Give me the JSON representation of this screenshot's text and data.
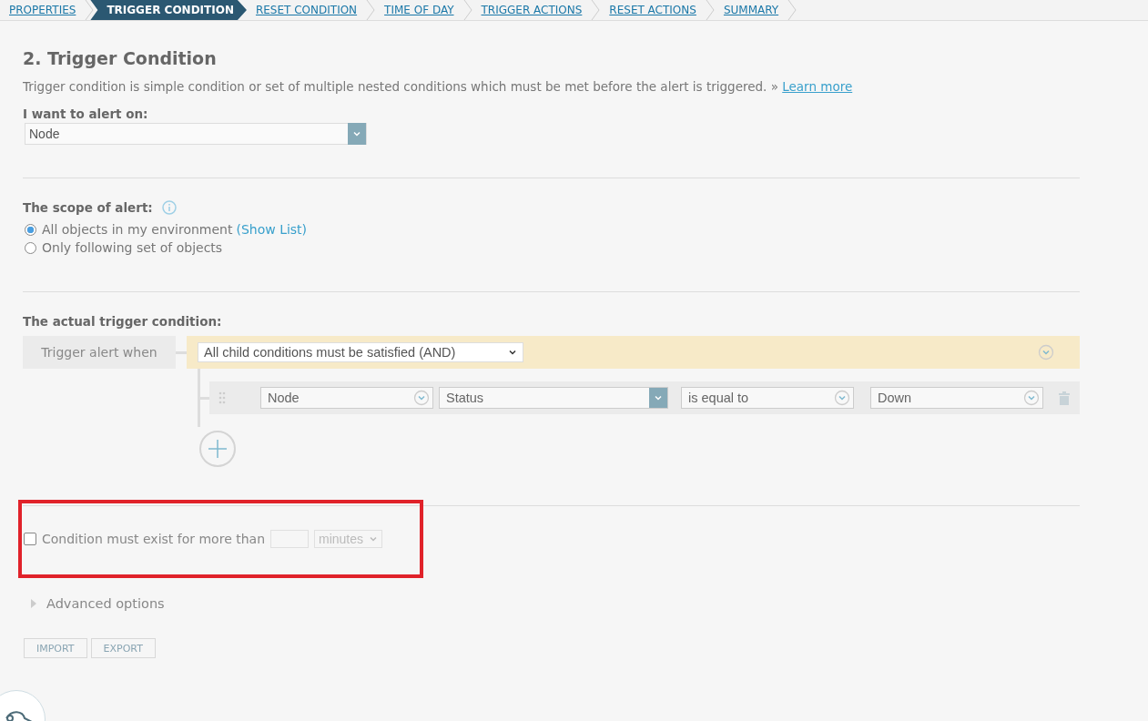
{
  "breadcrumb": [
    {
      "label": "PROPERTIES",
      "selected": false
    },
    {
      "label": "TRIGGER CONDITION",
      "selected": true
    },
    {
      "label": "RESET CONDITION",
      "selected": false
    },
    {
      "label": "TIME OF DAY",
      "selected": false
    },
    {
      "label": "TRIGGER ACTIONS",
      "selected": false
    },
    {
      "label": "RESET ACTIONS",
      "selected": false
    },
    {
      "label": "SUMMARY",
      "selected": false
    }
  ],
  "heading": "2. Trigger Condition",
  "description": "Trigger condition is simple condition or set of multiple nested conditions which must be met before the alert is triggered. »",
  "learn_more": "Learn more",
  "alert_on": {
    "label": "I want to alert on:",
    "value": "Node"
  },
  "scope": {
    "label": "The scope of alert:",
    "options": [
      {
        "label": "All objects in my environment",
        "link": "(Show List)",
        "selected": true
      },
      {
        "label": "Only following set of objects",
        "selected": false
      }
    ]
  },
  "trigger": {
    "label": "The actual trigger condition:",
    "when": "Trigger alert when",
    "group": "All child conditions must be satisfied (AND)",
    "conditions": [
      {
        "object": "Node",
        "field": "Status",
        "operator": "is equal to",
        "value": "Down"
      }
    ]
  },
  "duration": {
    "label": "Condition must exist for more than",
    "checked": false,
    "unit": "minutes"
  },
  "advanced": {
    "label": "Advanced options",
    "expanded": false
  },
  "buttons": [
    "IMPORT",
    "EXPORT"
  ]
}
